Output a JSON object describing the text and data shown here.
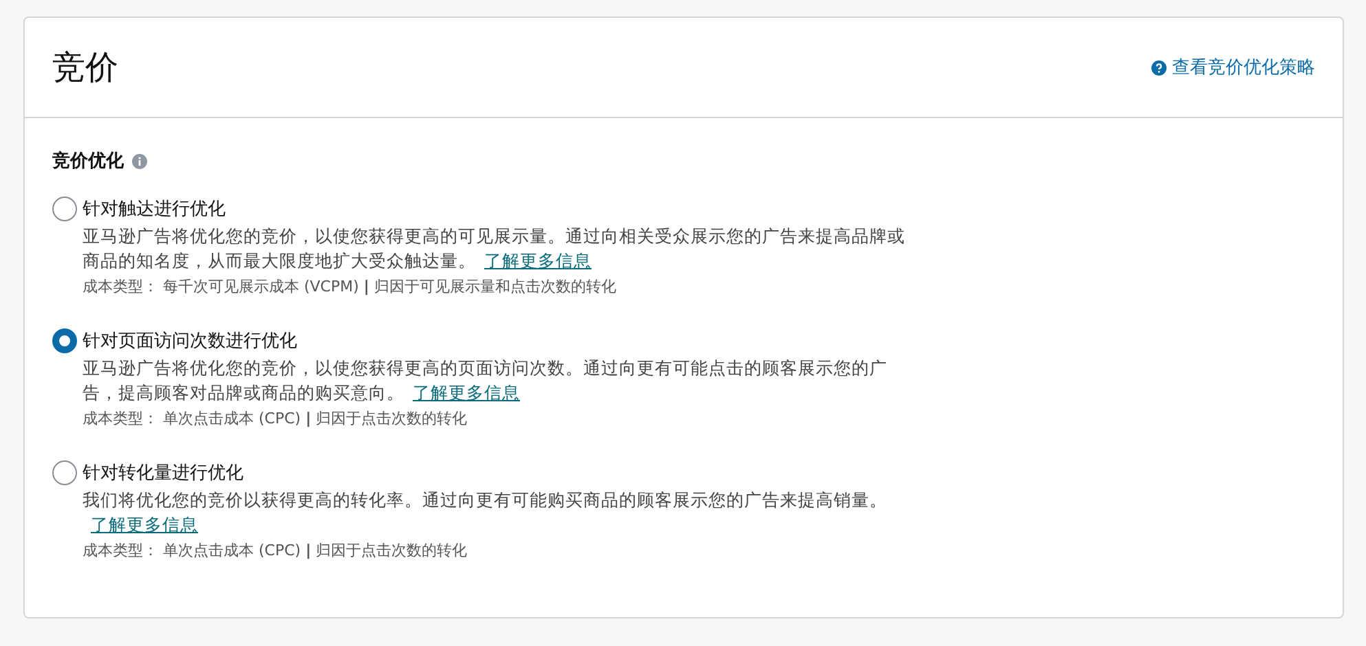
{
  "header": {
    "title": "竞价",
    "help_link": "查看竞价优化策略"
  },
  "section": {
    "title": "竞价优化",
    "options": [
      {
        "label": "针对触达进行优化",
        "selected": false,
        "description": "亚马逊广告将优化您的竞价，以使您获得更高的可见展示量。通过向相关受众展示您的广告来提高品牌或商品的知名度，从而最大限度地扩大受众触达量。",
        "link": "了解更多信息",
        "cost": "成本类型： 每千次可见展示成本 (VCPM) **|** 归因于可见展示量和点击次数的转化"
      },
      {
        "label": "针对页面访问次数进行优化",
        "selected": true,
        "description": "亚马逊广告将优化您的竞价，以使您获得更高的页面访问次数。通过向更有可能点击的顾客展示您的广告，提高顾客对品牌或商品的购买意向。",
        "link": "了解更多信息",
        "cost": "成本类型： 单次点击成本 (CPC) **|** 归因于点击次数的转化"
      },
      {
        "label": "针对转化量进行优化",
        "selected": false,
        "description": "我们将优化您的竞价以获得更高的转化率。通过向更有可能购买商品的顾客展示您的广告来提高销量。",
        "link": "了解更多信息",
        "cost": "成本类型： 单次点击成本 (CPC) **|** 归因于点击次数的转化"
      }
    ]
  }
}
